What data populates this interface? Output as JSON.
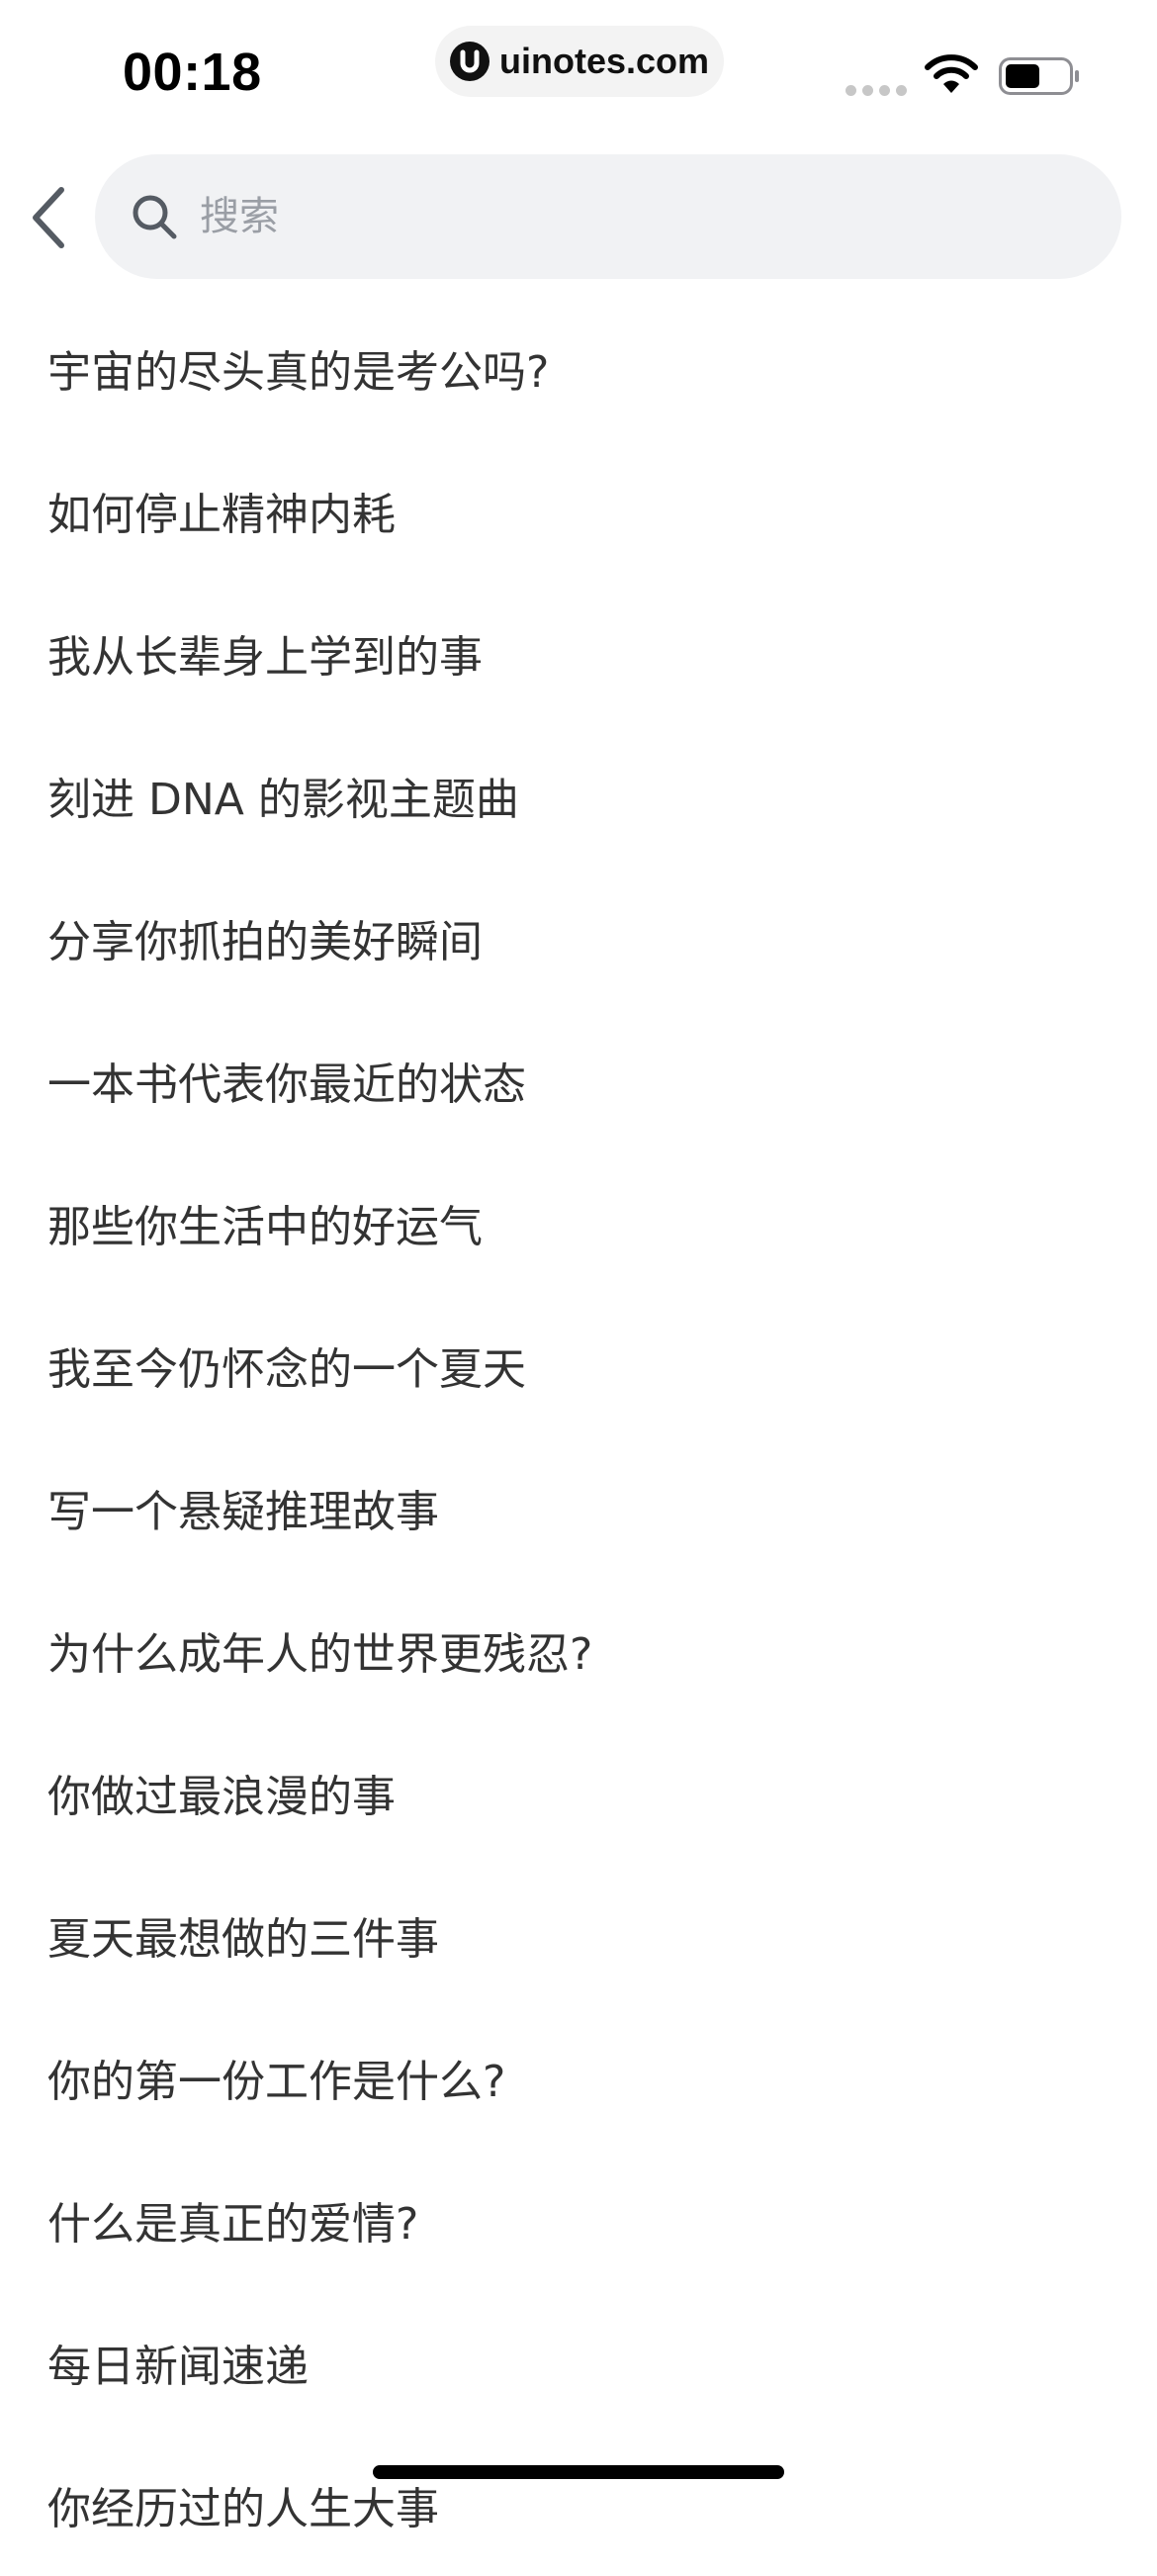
{
  "status_bar": {
    "time": "00:18",
    "url": "uinotes.com"
  },
  "search": {
    "placeholder": "搜索",
    "value": ""
  },
  "suggestions": [
    "宇宙的尽头真的是考公吗?",
    "如何停止精神内耗",
    "我从长辈身上学到的事",
    "刻进 DNA 的影视主题曲",
    "分享你抓拍的美好瞬间",
    "一本书代表你最近的状态",
    "那些你生活中的好运气",
    "我至今仍怀念的一个夏天",
    "写一个悬疑推理故事",
    "为什么成年人的世界更残忍?",
    "你做过最浪漫的事",
    "夏天最想做的三件事",
    "你的第一份工作是什么?",
    "什么是真正的爱情?",
    "每日新闻速递",
    "你经历过的人生大事"
  ],
  "icons": {
    "back": "chevron-left-icon",
    "search": "search-icon",
    "wifi": "wifi-icon",
    "battery": "battery-icon",
    "logo": "uinotes-logo-icon"
  },
  "colors": {
    "search_bg": "#f1f2f4",
    "text": "#333333",
    "placeholder": "#9a9ea5",
    "icon_gray": "#555b63"
  },
  "battery_level": 0.55
}
